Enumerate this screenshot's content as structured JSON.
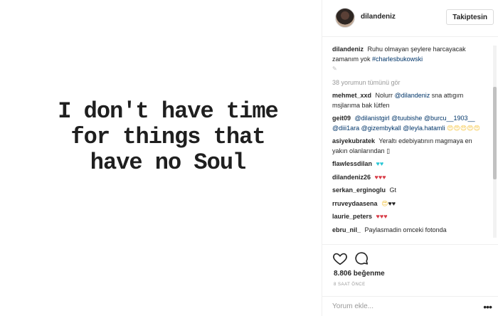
{
  "post": {
    "quote_lines": [
      "I don't have time",
      "for things that",
      "have no Soul"
    ]
  },
  "header": {
    "username": "dilandeniz",
    "follow_label": "Takiptesin"
  },
  "caption": {
    "username": "dilandeniz",
    "text": "Ruhu olmayan şeylere harcayacak zamanım yok",
    "hashtag": "#charlesbukowski",
    "edit_mark": "✎"
  },
  "view_all": "38 yorumun tümünü gör",
  "comments": [
    {
      "user": "mehmet_xxd",
      "pre": "Nolurr",
      "mention": "@dilandeniz",
      "post": "sna attıgım msjlarıma bak lütfen"
    },
    {
      "user": "geit09",
      "mentions": "@dilanistgirl @tuubishe @burcu__1903__ @diii1ara @gizembykall @leyla.hatamli",
      "emoji": "😍😍😍😍😍"
    },
    {
      "user": "asiyekubratek",
      "text": "Yeraltı edebiyatının magmaya en yakın olanlarından",
      "tail": "▯"
    },
    {
      "user": "flawlessdilan",
      "emoji": "♥♥"
    },
    {
      "user": "dilandeniz26",
      "emoji": "♥♥♥"
    },
    {
      "user": "serkan_erginoglu",
      "text": "Gt"
    },
    {
      "user": "rruveydaasena",
      "emoji_y": "😍",
      "emoji_k": "♥♥"
    },
    {
      "user": "laurie_peters",
      "emoji": "♥♥♥"
    },
    {
      "user": "ebru_nil_",
      "text": "Paylasmadin omceki fotonda"
    }
  ],
  "actions": {
    "likes": "8.806 beğenme",
    "time": "8 SAAT ÖNCE"
  },
  "add_comment": {
    "placeholder": "Yorum ekle...",
    "more": "•••"
  },
  "colors": {
    "link": "#003569",
    "muted": "#999999",
    "border": "#efefef"
  }
}
